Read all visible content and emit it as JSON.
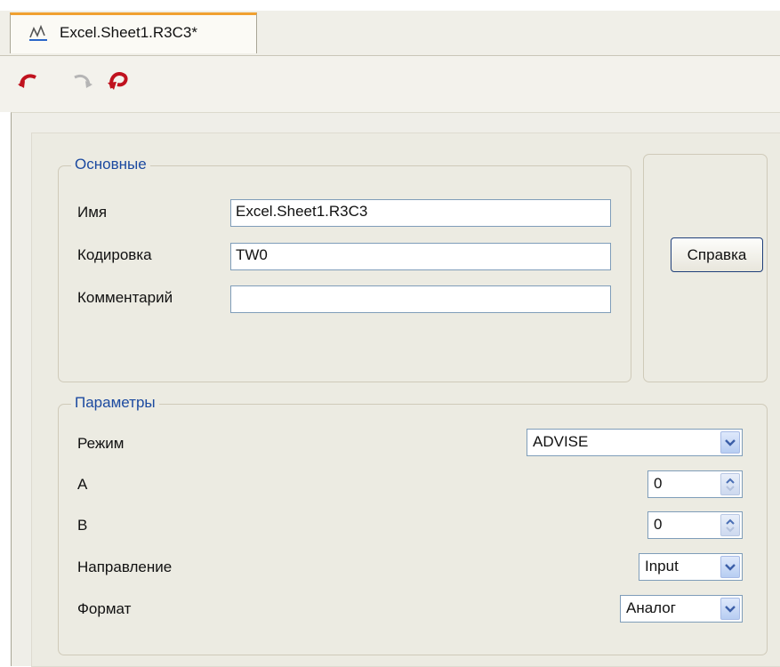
{
  "tab": {
    "title": "Excel.Sheet1.R3C3*",
    "icon": "chart-line-icon"
  },
  "toolbar": {
    "undo_icon": "undo-icon",
    "redo_icon": "redo-icon",
    "undo_all_icon": "undo-all-icon"
  },
  "main_group": {
    "legend": "Основные",
    "name_label": "Имя",
    "name_value": "Excel.Sheet1.R3C3",
    "encoding_label": "Кодировка",
    "encoding_value": "TW0",
    "comment_label": "Комментарий",
    "comment_value": ""
  },
  "help_button": "Справка",
  "params_group": {
    "legend": "Параметры",
    "mode_label": "Режим",
    "mode_value": "ADVISE",
    "a_label": "A",
    "a_value": "0",
    "b_label": "B",
    "b_value": "0",
    "direction_label": "Направление",
    "direction_value": "Input",
    "format_label": "Формат",
    "format_value": "Аналог"
  },
  "colors": {
    "tab_accent": "#f0a030",
    "legend_text": "#1c4aa0",
    "icon_red": "#c0121e"
  }
}
